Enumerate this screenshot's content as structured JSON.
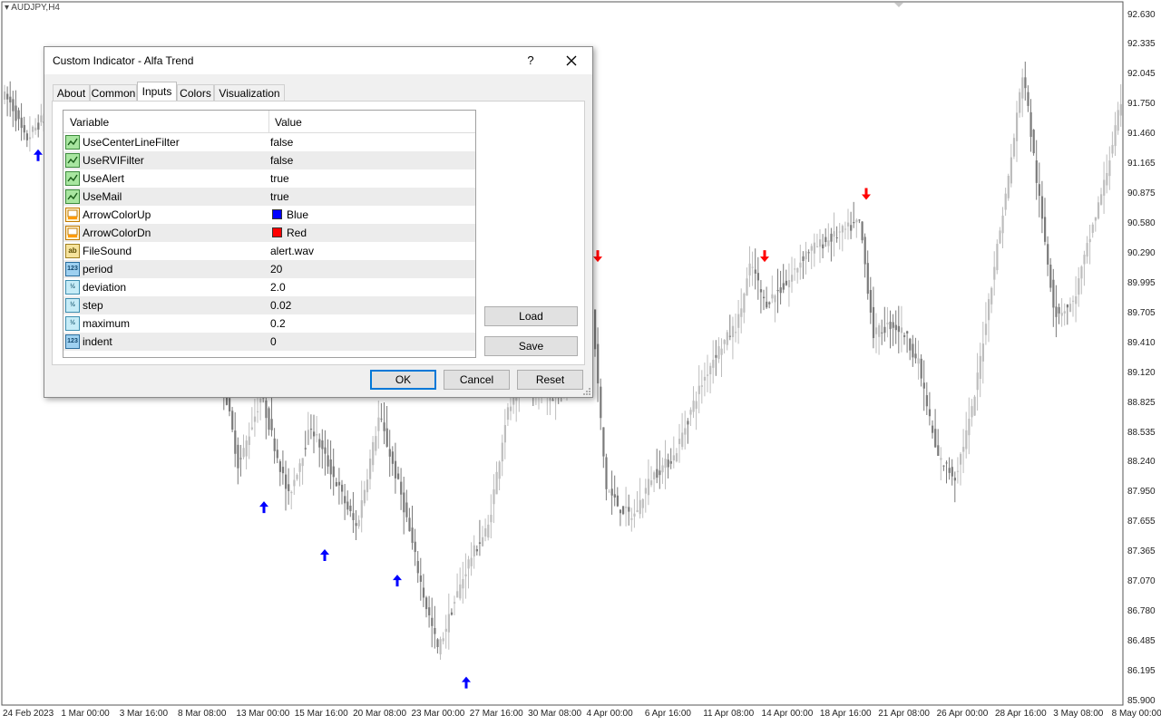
{
  "chart": {
    "symbol": "AUDJPY,H4",
    "price_ticks": [
      "92.630",
      "92.335",
      "92.045",
      "91.750",
      "91.460",
      "91.165",
      "90.875",
      "90.580",
      "90.290",
      "89.995",
      "89.705",
      "89.410",
      "89.120",
      "88.825",
      "88.535",
      "88.240",
      "87.950",
      "87.655",
      "87.365",
      "87.070",
      "86.780",
      "86.485",
      "86.195",
      "85.900"
    ],
    "time_ticks": [
      "24 Feb 2023",
      "1 Mar 00:00",
      "3 Mar 16:00",
      "8 Mar 08:00",
      "13 Mar 00:00",
      "15 Mar 16:00",
      "20 Mar 08:00",
      "23 Mar 00:00",
      "27 Mar 16:00",
      "30 Mar 08:00",
      "4 Apr 00:00",
      "6 Apr 16:00",
      "11 Apr 08:00",
      "14 Apr 00:00",
      "18 Apr 16:00",
      "21 Apr 08:00",
      "26 Apr 00:00",
      "28 Apr 16:00",
      "3 May 08:00",
      "8 May 00:00"
    ],
    "colors": {
      "bull": "#bdbdbd",
      "bear": "#7a7a7a",
      "arrow_up": "#0000ff",
      "arrow_down": "#ff0000"
    },
    "path": [
      [
        0,
        91.9
      ],
      [
        15,
        91.75
      ],
      [
        30,
        91.4
      ],
      [
        48,
        91.6
      ],
      [
        80,
        91.7
      ],
      [
        120,
        91.4
      ],
      [
        160,
        91.2
      ],
      [
        200,
        90.9
      ],
      [
        245,
        89.2
      ],
      [
        265,
        88.2
      ],
      [
        290,
        88.9
      ],
      [
        320,
        87.9
      ],
      [
        345,
        88.6
      ],
      [
        370,
        88.1
      ],
      [
        395,
        87.6
      ],
      [
        420,
        88.7
      ],
      [
        445,
        87.9
      ],
      [
        470,
        86.9
      ],
      [
        485,
        86.4
      ],
      [
        500,
        86.8
      ],
      [
        520,
        87.3
      ],
      [
        540,
        87.6
      ],
      [
        560,
        88.7
      ],
      [
        580,
        89.1
      ],
      [
        600,
        88.9
      ],
      [
        620,
        88.9
      ],
      [
        640,
        89.6
      ],
      [
        655,
        89.7
      ],
      [
        670,
        88.0
      ],
      [
        685,
        87.8
      ],
      [
        700,
        87.7
      ],
      [
        720,
        88.1
      ],
      [
        745,
        88.3
      ],
      [
        770,
        88.9
      ],
      [
        790,
        89.3
      ],
      [
        815,
        89.6
      ],
      [
        830,
        90.2
      ],
      [
        845,
        89.8
      ],
      [
        870,
        90.0
      ],
      [
        890,
        90.3
      ],
      [
        910,
        90.4
      ],
      [
        930,
        90.5
      ],
      [
        950,
        90.6
      ],
      [
        965,
        89.5
      ],
      [
        985,
        89.6
      ],
      [
        1000,
        89.5
      ],
      [
        1015,
        89.2
      ],
      [
        1035,
        88.3
      ],
      [
        1055,
        88.1
      ],
      [
        1075,
        88.8
      ],
      [
        1095,
        90.0
      ],
      [
        1115,
        91.1
      ],
      [
        1130,
        92.1
      ],
      [
        1145,
        91.0
      ],
      [
        1165,
        89.7
      ],
      [
        1185,
        89.8
      ],
      [
        1205,
        90.5
      ],
      [
        1220,
        91.0
      ],
      [
        1236,
        91.7
      ]
    ],
    "arrows_up": [
      [
        42,
        91.25
      ],
      [
        291,
        87.8
      ],
      [
        358,
        87.33
      ],
      [
        438,
        87.08
      ],
      [
        514,
        86.08
      ]
    ],
    "arrows_down": [
      [
        659,
        90.27
      ],
      [
        843,
        90.27
      ],
      [
        955,
        90.88
      ]
    ]
  },
  "dialog": {
    "title": "Custom Indicator - Alfa Trend",
    "help_label": "?",
    "tabs": [
      {
        "label": "About",
        "active": false
      },
      {
        "label": "Common",
        "active": false
      },
      {
        "label": "Inputs",
        "active": true
      },
      {
        "label": "Colors",
        "active": false
      },
      {
        "label": "Visualization",
        "active": false
      }
    ],
    "columns": {
      "variable": "Variable",
      "value": "Value"
    },
    "rows": [
      {
        "type": "bool",
        "icon": "bool-param-icon",
        "name": "UseCenterLineFilter",
        "value": "false"
      },
      {
        "type": "bool",
        "icon": "bool-param-icon",
        "name": "UseRVIFilter",
        "value": "false"
      },
      {
        "type": "bool",
        "icon": "bool-param-icon",
        "name": "UseAlert",
        "value": "true"
      },
      {
        "type": "bool",
        "icon": "bool-param-icon",
        "name": "UseMail",
        "value": "true"
      },
      {
        "type": "color",
        "icon": "color-param-icon",
        "name": "ArrowColorUp",
        "value": "Blue",
        "swatch": "#0000ff"
      },
      {
        "type": "color",
        "icon": "color-param-icon",
        "name": "ArrowColorDn",
        "value": "Red",
        "swatch": "#ff0000"
      },
      {
        "type": "str",
        "icon": "string-param-icon",
        "icon_text": "ab",
        "name": "FileSound",
        "value": "alert.wav"
      },
      {
        "type": "int",
        "icon": "integer-param-icon",
        "icon_text": "123",
        "name": "period",
        "value": "20"
      },
      {
        "type": "dbl",
        "icon": "double-param-icon",
        "icon_text": "½",
        "name": "deviation",
        "value": "2.0"
      },
      {
        "type": "dbl",
        "icon": "double-param-icon",
        "icon_text": "½",
        "name": "step",
        "value": "0.02"
      },
      {
        "type": "dbl",
        "icon": "double-param-icon",
        "icon_text": "½",
        "name": "maximum",
        "value": "0.2"
      },
      {
        "type": "int",
        "icon": "integer-param-icon",
        "icon_text": "123",
        "name": "indent",
        "value": "0"
      }
    ],
    "buttons": {
      "load": "Load",
      "save": "Save",
      "ok": "OK",
      "cancel": "Cancel",
      "reset": "Reset"
    }
  }
}
